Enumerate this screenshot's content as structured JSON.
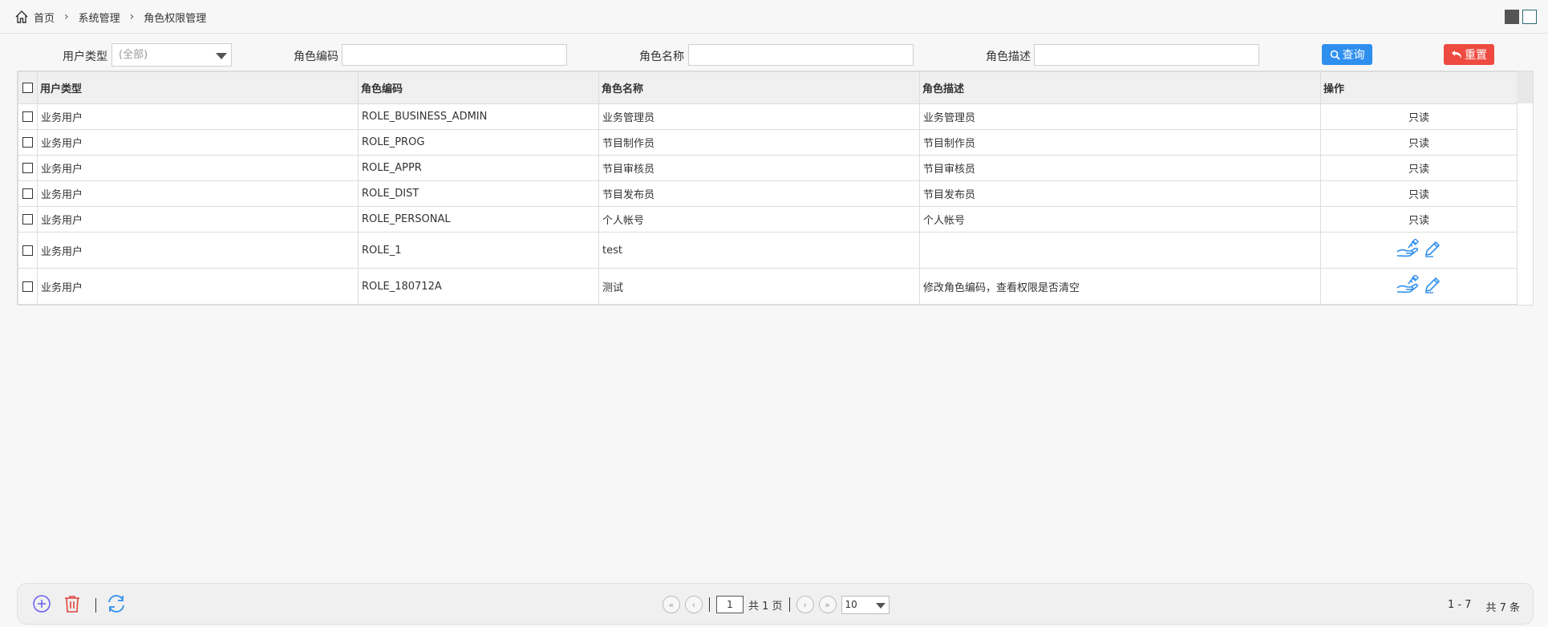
{
  "breadcrumb": {
    "home": "首页",
    "level1": "系统管理",
    "level2": "角色权限管理"
  },
  "filters": {
    "user_type_label": "用户类型",
    "user_type_value": "(全部)",
    "role_code_label": "角色编码",
    "role_code_value": "",
    "role_name_label": "角色名称",
    "role_name_value": "",
    "role_desc_label": "角色描述",
    "role_desc_value": "",
    "search_label": "查询",
    "reset_label": "重置"
  },
  "table": {
    "headers": [
      "用户类型",
      "角色编码",
      "角色名称",
      "角色描述",
      "操作"
    ],
    "rows": [
      {
        "user_type": "业务用户",
        "code": "ROLE_BUSINESS_ADMIN",
        "name": "业务管理员",
        "desc": "业务管理员",
        "op": "只读"
      },
      {
        "user_type": "业务用户",
        "code": "ROLE_PROG",
        "name": "节目制作员",
        "desc": "节目制作员",
        "op": "只读"
      },
      {
        "user_type": "业务用户",
        "code": "ROLE_APPR",
        "name": "节目审核员",
        "desc": "节目审核员",
        "op": "只读"
      },
      {
        "user_type": "业务用户",
        "code": "ROLE_DIST",
        "name": "节目发布员",
        "desc": "节目发布员",
        "op": "只读"
      },
      {
        "user_type": "业务用户",
        "code": "ROLE_PERSONAL",
        "name": "个人帐号",
        "desc": "个人帐号",
        "op": "只读"
      },
      {
        "user_type": "业务用户",
        "code": "ROLE_1",
        "name": "test",
        "desc": "",
        "op": ""
      },
      {
        "user_type": "业务用户",
        "code": "ROLE_180712A",
        "name": "测试",
        "desc": "修改角色编码，查看权限是否清空",
        "op": ""
      }
    ]
  },
  "footer": {
    "page_current": "1",
    "page_total": "共 1 页",
    "page_size": "10",
    "range": "1 - 7",
    "total": "共 7 条"
  },
  "colors": {
    "search_button": "#2f8fee",
    "reset_button": "#ee4a3f",
    "action_icon": "#2f8fee",
    "delete_icon": "#e0463c"
  },
  "icons": [
    "home-icon",
    "chevron-right-icon",
    "search-icon",
    "undo-icon",
    "assign-permission-icon",
    "edit-icon",
    "add-icon",
    "delete-icon",
    "refresh-icon",
    "first-page-icon",
    "prev-page-icon",
    "next-page-icon",
    "last-page-icon"
  ]
}
